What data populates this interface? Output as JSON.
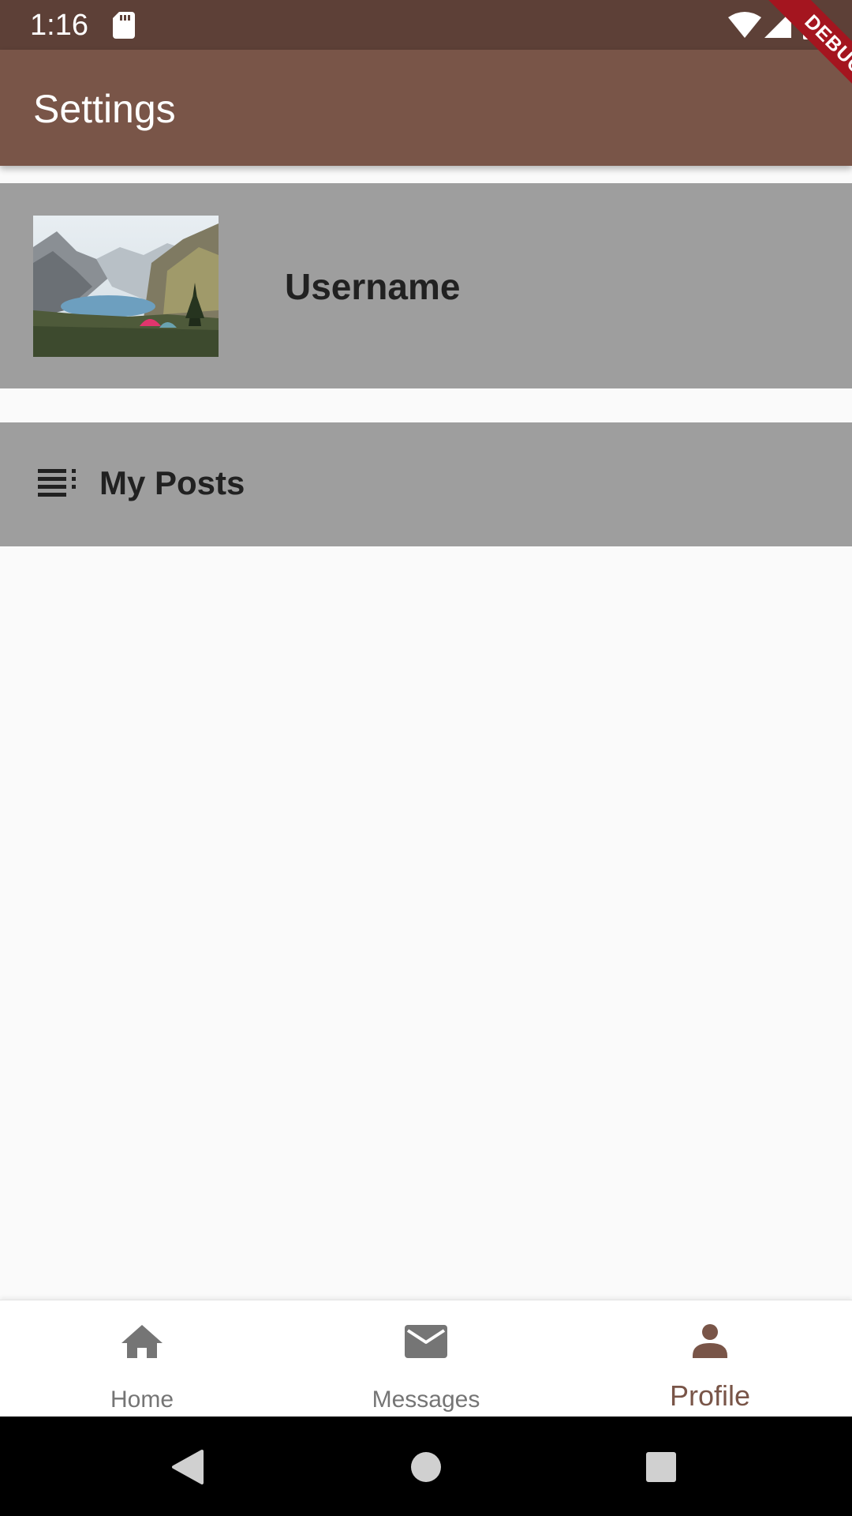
{
  "status_bar": {
    "time": "1:16",
    "icons": [
      "sd-card-icon",
      "wifi-icon",
      "signal-icon",
      "battery-charging-icon"
    ]
  },
  "debug_banner": {
    "label": "DEBUG"
  },
  "app_bar": {
    "title": "Settings"
  },
  "profile": {
    "username": "Username",
    "avatar_icon": "landscape-photo"
  },
  "menu": {
    "my_posts": {
      "label": "My Posts",
      "icon": "list-icon"
    }
  },
  "bottom_nav": {
    "items": [
      {
        "label": "Home",
        "icon": "home-icon",
        "active": false
      },
      {
        "label": "Messages",
        "icon": "mail-icon",
        "active": false
      },
      {
        "label": "Profile",
        "icon": "person-icon",
        "active": true
      }
    ]
  },
  "colors": {
    "status_bar": "#5d4037",
    "app_bar": "#795548",
    "card_background": "#9e9e9e",
    "page_background": "#fafafa",
    "active_nav": "#795548",
    "inactive_nav": "#757575",
    "debug_banner": "#a4151f"
  }
}
